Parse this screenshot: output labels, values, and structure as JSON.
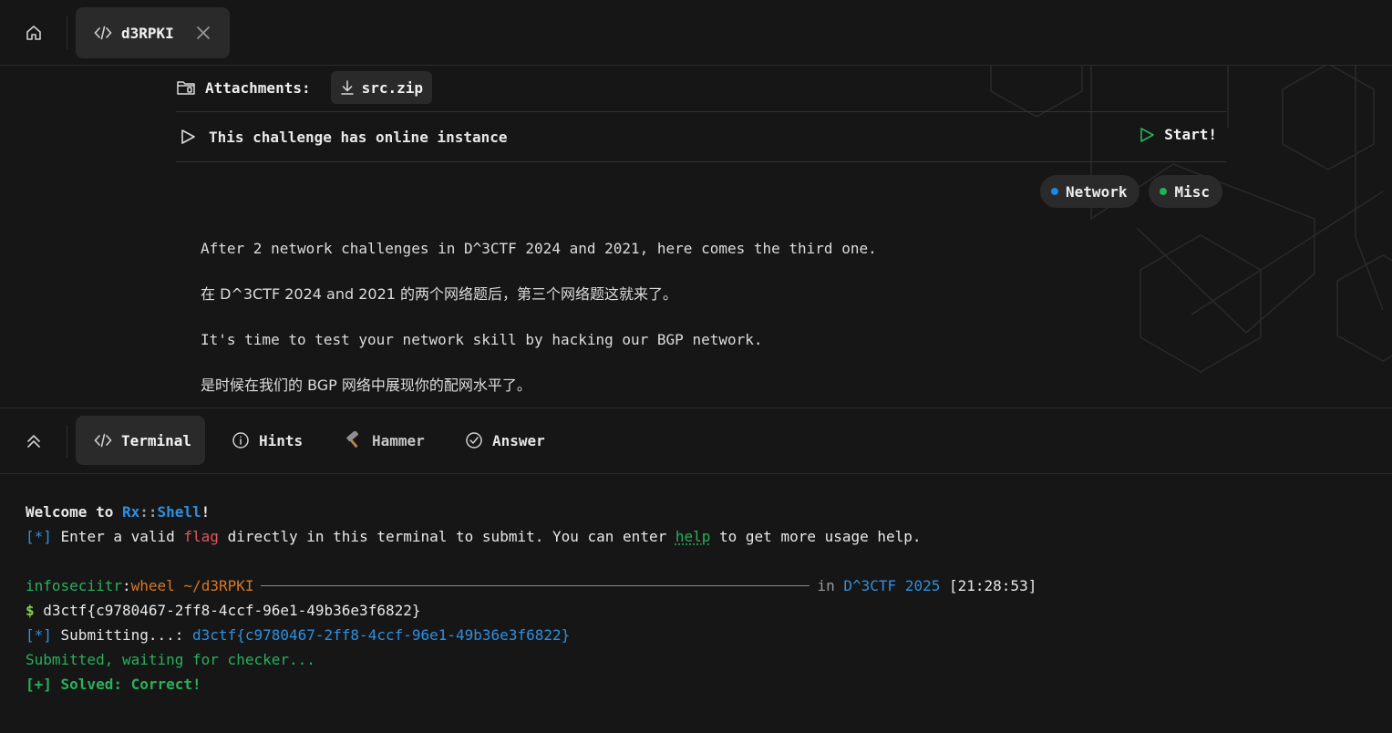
{
  "top_tabs": {
    "home_icon": "home-icon",
    "active_tab": {
      "icon": "code-icon",
      "label": "d3RPKI",
      "close_icon": "close-icon"
    }
  },
  "challenge": {
    "attachments_label": "Attachments:",
    "attachment_file": "src.zip",
    "instance_text": "This challenge has online instance",
    "start_label": "Start!",
    "tags": [
      {
        "label": "Network",
        "color": "#1e88e5"
      },
      {
        "label": "Misc",
        "color": "#22b35a"
      }
    ],
    "description": [
      "After 2 network challenges in D^3CTF 2024 and 2021, here comes the third one.",
      "在 D^3CTF 2024 and 2021 的两个网络题后，第三个网络题这就来了。",
      "It's time to test your network skill by hacking our BGP network.",
      "是时候在我们的 BGP 网络中展现你的配网水平了。"
    ]
  },
  "panel_tabs": [
    {
      "label": "Terminal",
      "icon": "code-icon"
    },
    {
      "label": "Hints",
      "icon": "info-icon"
    },
    {
      "label": "Hammer",
      "icon": "hammer-icon"
    },
    {
      "label": "Answer",
      "icon": "check-circle-icon"
    }
  ],
  "terminal": {
    "welcome": {
      "prefix": "Welcome to ",
      "rx": "Rx",
      "sep": "::",
      "shell": "Shell",
      "suffix": "!"
    },
    "info": {
      "marker": "[*]",
      "t1": " Enter a valid ",
      "flag": "flag",
      "t2": " directly in this terminal to submit. You can enter ",
      "help": "help",
      "t3": " to get more usage help."
    },
    "prompt": {
      "user": "infoseciitr",
      "colon": ":",
      "group": "wheel",
      "path": "~/d3RPKI",
      "in": "in",
      "event": "D^3CTF 2025",
      "time": "[21:28:53]"
    },
    "command": {
      "dollar": "$",
      "text": " d3ctf{c9780467-2ff8-4ccf-96e1-49b36e3f6822}"
    },
    "submitting": {
      "marker": "[*]",
      "text": " Submitting...: ",
      "flag": "d3ctf{c9780467-2ff8-4ccf-96e1-49b36e3f6822}"
    },
    "waiting": "Submitted, waiting for checker...",
    "solved": "[+] Solved: Correct!"
  }
}
